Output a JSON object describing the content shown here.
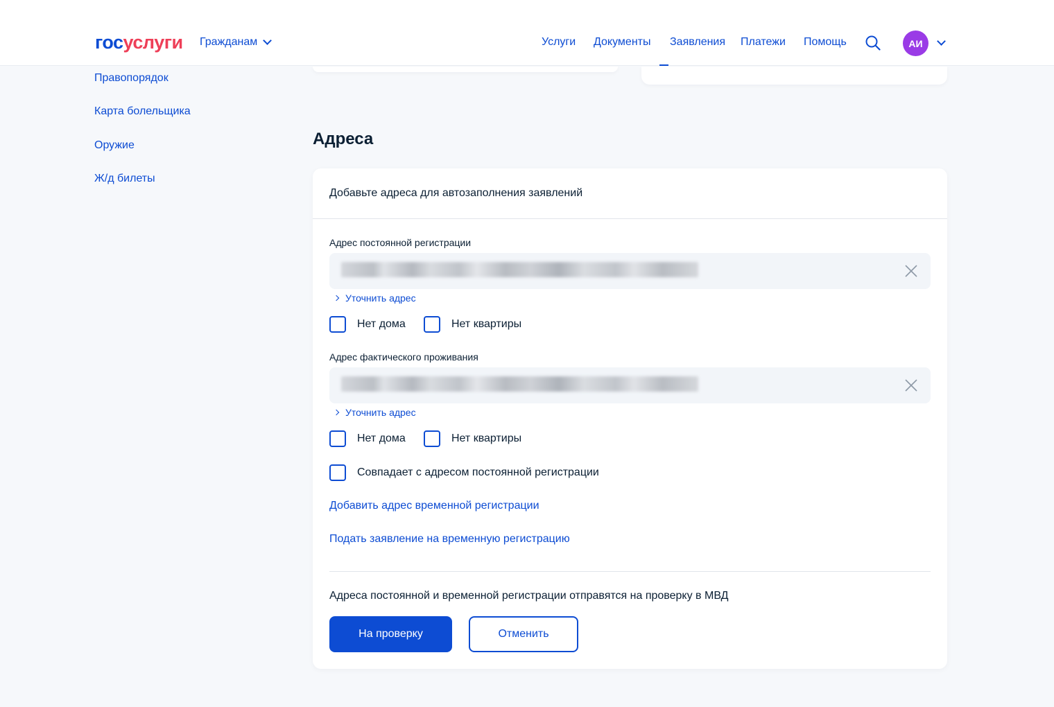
{
  "header": {
    "logo_part1": "гос",
    "logo_part2": "услуги",
    "audience_menu": "Гражданам",
    "nav": [
      "Услуги",
      "Документы",
      "Заявления",
      "Платежи",
      "Помощь"
    ],
    "avatar_initials": "АИ"
  },
  "sidebar": {
    "items": [
      {
        "label": "Правопорядок"
      },
      {
        "label": "Карта болельщика"
      },
      {
        "label": "Оружие"
      },
      {
        "label": "Ж/д билеты"
      }
    ]
  },
  "addresses": {
    "title": "Адреса",
    "intro": "Добавьте адреса для автозаполнения заявлений",
    "permanent": {
      "label": "Адрес постоянной регистрации",
      "refine": "Уточнить адрес",
      "no_house": "Нет дома",
      "no_flat": "Нет квартиры"
    },
    "actual": {
      "label": "Адрес фактического проживания",
      "refine": "Уточнить адрес",
      "no_house": "Нет дома",
      "no_flat": "Нет квартиры",
      "same_as_permanent": "Совпадает с адресом постоянной регистрации"
    },
    "add_temp_link": "Добавить адрес временной регистрации",
    "apply_temp_link": "Подать заявление на временную регистрацию",
    "note": "Адреса постоянной и временной регистрации отправятся на проверку в МВД",
    "submit_button": "На проверку",
    "cancel_button": "Отменить"
  },
  "colors": {
    "accent": "#0d4cd3",
    "logo_red": "#ee3f58",
    "avatar_bg": "#9a3be6",
    "page_bg": "#f6f8fb"
  }
}
